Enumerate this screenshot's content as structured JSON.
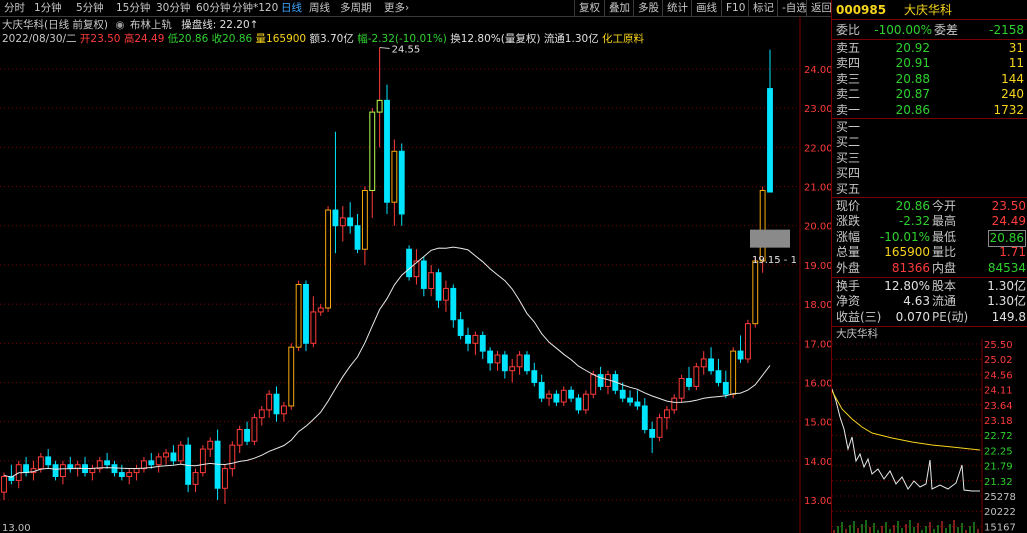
{
  "toolbar": {
    "periods": [
      "分时",
      "1分钟",
      "5分钟",
      "15分钟",
      "30分钟",
      "60分钟",
      "分钟*120",
      "日线",
      "周线",
      "多周期",
      "更多›"
    ],
    "active_period": "日线",
    "right_buttons": [
      "复权",
      "叠加",
      "多股",
      "统计",
      "画线",
      "F10",
      "标记",
      "-自选",
      "返回"
    ]
  },
  "chart_header": {
    "line1_title": "大庆华科(日线 前复权)",
    "line1_indicator": "布林上轨",
    "line1_cost": "操盘线: 22.20↑",
    "date": "2022/08/30/二",
    "open_label": "开",
    "open": "23.50",
    "high_label": "高",
    "high": "24.49",
    "low_label": "低",
    "low": "20.86",
    "close_label": "收",
    "close": "20.86",
    "volume_label": "量",
    "volume": "165900",
    "amount_label": "额",
    "amount": "3.70亿",
    "change_label": "幅",
    "change": "-2.32(-10.01%)",
    "turnover": "换12.80%(量复权)",
    "float_share": "流通1.30亿",
    "industry": "化工原料"
  },
  "annotations": {
    "peak_label": "24.55",
    "price_tag": "19.15 - 1",
    "bottom_left": "13.00"
  },
  "price_axis": {
    "ticks": [
      "24.00",
      "23.00",
      "22.00",
      "21.00",
      "20.00",
      "19.00",
      "18.00",
      "17.00",
      "16.00",
      "15.00",
      "14.00",
      "13.00"
    ]
  },
  "colors": {
    "up": "#ff3b3b",
    "down": "#00e5ff",
    "up_strong": "#f7a90d",
    "ma": "#e8e8e8",
    "highlight": "#b8ff4d",
    "grid": "#7a0000",
    "text": "#c0c0c0"
  },
  "quote": {
    "code": "000985",
    "name": "大庆华科",
    "weibi_label": "委比",
    "weibi": "-100.00%",
    "weicha_label": "委差",
    "weicha": "-2158",
    "asks": [
      {
        "label": "卖五",
        "price": "20.92",
        "vol": "31"
      },
      {
        "label": "卖四",
        "price": "20.91",
        "vol": "11"
      },
      {
        "label": "卖三",
        "price": "20.88",
        "vol": "144"
      },
      {
        "label": "卖二",
        "price": "20.87",
        "vol": "240"
      },
      {
        "label": "卖一",
        "price": "20.86",
        "vol": "1732"
      }
    ],
    "bids": [
      {
        "label": "买一"
      },
      {
        "label": "买二"
      },
      {
        "label": "买三"
      },
      {
        "label": "买四"
      },
      {
        "label": "买五"
      }
    ],
    "stats": [
      {
        "l1": "现价",
        "v1": "20.86",
        "l2": "今开",
        "v2": "23.50"
      },
      {
        "l1": "涨跌",
        "v1": "-2.32",
        "l2": "最高",
        "v2": "24.49"
      },
      {
        "l1": "涨幅",
        "v1": "-10.01%",
        "l2": "最低",
        "v2": "20.86"
      },
      {
        "l1": "总量",
        "v1": "165900",
        "l2": "量比",
        "v2": "1.71"
      },
      {
        "l1": "外盘",
        "v1": "81366",
        "l2": "内盘",
        "v2": "84534"
      }
    ],
    "stats2": [
      {
        "l1": "换手",
        "v1": "12.80%",
        "l2": "股本",
        "v2": "1.30亿"
      },
      {
        "l1": "净资",
        "v1": "4.63",
        "l2": "流通",
        "v2": "1.30亿"
      },
      {
        "l1": "收益(三)",
        "v1": "0.070",
        "l2": "PE(动)",
        "v2": "149.8"
      }
    ],
    "mini_title": "大庆华科",
    "mini_ticks": [
      "25.50",
      "25.02",
      "24.56",
      "24.11",
      "23.64",
      "23.18",
      "22.72",
      "22.25",
      "21.79",
      "21.32",
      "25278",
      "20222",
      "15167"
    ]
  }
}
